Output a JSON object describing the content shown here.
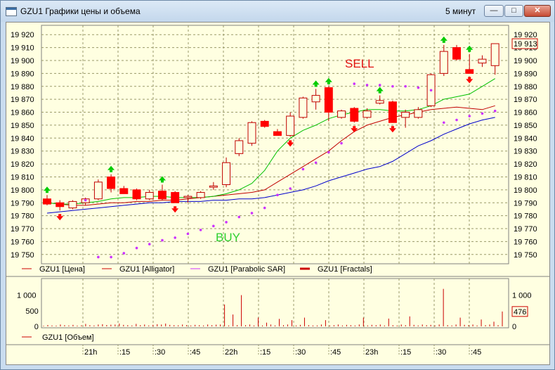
{
  "window": {
    "title": "GZU1 Графики цены и объема",
    "period": "5 минут",
    "btn_min": "—",
    "btn_max": "□",
    "btn_close": "✕"
  },
  "icons": [
    "chart-window-icon",
    "minimize-icon",
    "maximize-icon",
    "close-icon"
  ],
  "colors": {
    "background": "#ffffe1",
    "bear_candle": "#ff0000",
    "bull_candle_border": "#c00000",
    "alligator_green": "#00c000",
    "alligator_red": "#c00000",
    "alligator_blue": "#0000cc",
    "sar": "#cc33ff",
    "fractal_up": "#00cc00",
    "fractal_down": "#ff0000",
    "volume": "#cc0000"
  },
  "chart_data": [
    {
      "type": "candlestick",
      "ylim": [
        19745,
        19925
      ],
      "yticks": [
        19750,
        19760,
        19770,
        19780,
        19790,
        19800,
        19810,
        19820,
        19830,
        19840,
        19850,
        19860,
        19870,
        19880,
        19890,
        19900,
        19910,
        19920
      ],
      "ytick_labels": [
        "19 750",
        "19 760",
        "19 770",
        "19 780",
        "19 790",
        "19 800",
        "19 810",
        "19 820",
        "19 830",
        "19 840",
        "19 850",
        "19 860",
        "19 870",
        "19 880",
        "19 890",
        "19 900",
        "19 910",
        "19 920"
      ],
      "last_price_label": "19 913",
      "grid": true,
      "candles": [
        {
          "o": 19793,
          "h": 19796,
          "l": 19788,
          "c": 19789
        },
        {
          "o": 19790,
          "h": 19792,
          "l": 19784,
          "c": 19787
        },
        {
          "o": 19786,
          "h": 19792,
          "l": 19785,
          "c": 19791
        },
        {
          "o": 19790,
          "h": 19794,
          "l": 19788,
          "c": 19793
        },
        {
          "o": 19793,
          "h": 19808,
          "l": 19792,
          "c": 19806
        },
        {
          "o": 19810,
          "h": 19812,
          "l": 19798,
          "c": 19801
        },
        {
          "o": 19801,
          "h": 19803,
          "l": 19797,
          "c": 19797
        },
        {
          "o": 19800,
          "h": 19801,
          "l": 19792,
          "c": 19793
        },
        {
          "o": 19793,
          "h": 19800,
          "l": 19792,
          "c": 19798
        },
        {
          "o": 19799,
          "h": 19804,
          "l": 19792,
          "c": 19793
        },
        {
          "o": 19798,
          "h": 19799,
          "l": 19790,
          "c": 19790
        },
        {
          "o": 19794,
          "h": 19796,
          "l": 19790,
          "c": 19795
        },
        {
          "o": 19794,
          "h": 19799,
          "l": 19793,
          "c": 19798
        },
        {
          "o": 19802,
          "h": 19806,
          "l": 19800,
          "c": 19803
        },
        {
          "o": 19804,
          "h": 19825,
          "l": 19802,
          "c": 19821
        },
        {
          "o": 19828,
          "h": 19840,
          "l": 19826,
          "c": 19838
        },
        {
          "o": 19836,
          "h": 19853,
          "l": 19834,
          "c": 19852
        },
        {
          "o": 19853,
          "h": 19854,
          "l": 19848,
          "c": 19849
        },
        {
          "o": 19845,
          "h": 19847,
          "l": 19842,
          "c": 19842
        },
        {
          "o": 19842,
          "h": 19860,
          "l": 19841,
          "c": 19857
        },
        {
          "o": 19856,
          "h": 19872,
          "l": 19855,
          "c": 19871
        },
        {
          "o": 19868,
          "h": 19878,
          "l": 19862,
          "c": 19873
        },
        {
          "o": 19879,
          "h": 19880,
          "l": 19853,
          "c": 19860
        },
        {
          "o": 19856,
          "h": 19862,
          "l": 19855,
          "c": 19861
        },
        {
          "o": 19863,
          "h": 19864,
          "l": 19852,
          "c": 19853
        },
        {
          "o": 19856,
          "h": 19863,
          "l": 19855,
          "c": 19861
        },
        {
          "o": 19867,
          "h": 19873,
          "l": 19866,
          "c": 19869
        },
        {
          "o": 19868,
          "h": 19869,
          "l": 19852,
          "c": 19852
        },
        {
          "o": 19856,
          "h": 19862,
          "l": 19848,
          "c": 19860
        },
        {
          "o": 19856,
          "h": 19864,
          "l": 19855,
          "c": 19862
        },
        {
          "o": 19865,
          "h": 19890,
          "l": 19864,
          "c": 19889
        },
        {
          "o": 19890,
          "h": 19912,
          "l": 19888,
          "c": 19907
        },
        {
          "o": 19910,
          "h": 19912,
          "l": 19900,
          "c": 19901
        },
        {
          "o": 19893,
          "h": 19905,
          "l": 19890,
          "c": 19890
        },
        {
          "o": 19898,
          "h": 19904,
          "l": 19895,
          "c": 19901
        },
        {
          "o": 19896,
          "h": 19913,
          "l": 19889,
          "c": 19913
        }
      ],
      "alligator_green": [
        19790,
        19789,
        19789,
        19790,
        19791,
        19793,
        19794,
        19794,
        19795,
        19795,
        19794,
        19794,
        19794,
        19795,
        19797,
        19800,
        19805,
        19815,
        19830,
        19840,
        19846,
        19850,
        19855,
        19858,
        19860,
        19862,
        19862,
        19861,
        19861,
        19862,
        19865,
        19870,
        19872,
        19874,
        19880,
        19886
      ],
      "alligator_red": [
        19790,
        19789,
        19788,
        19788,
        19789,
        19790,
        19790,
        19791,
        19791,
        19792,
        19792,
        19793,
        19794,
        19795,
        19796,
        19797,
        19798,
        19800,
        19806,
        19812,
        19818,
        19824,
        19830,
        19838,
        19845,
        19850,
        19853,
        19856,
        19858,
        19860,
        19862,
        19863,
        19864,
        19863,
        19862,
        19865
      ],
      "alligator_blue": [
        19782,
        19783,
        19784,
        19785,
        19786,
        19787,
        19788,
        19789,
        19790,
        19790,
        19791,
        19791,
        19791,
        19792,
        19792,
        19793,
        19793,
        19794,
        19796,
        19798,
        19800,
        19803,
        19807,
        19810,
        19813,
        19816,
        19818,
        19822,
        19828,
        19834,
        19838,
        19843,
        19847,
        19851,
        19854,
        19856
      ],
      "sar": [
        null,
        null,
        null,
        19792,
        19748,
        19748,
        19751,
        19755,
        19758,
        19761,
        19763,
        19766,
        19769,
        19772,
        19775,
        19779,
        19782,
        19786,
        19796,
        19801,
        19816,
        19821,
        19829,
        19836,
        19882,
        19881,
        19881,
        19880,
        19880,
        19879,
        19877,
        19852,
        19854,
        19857,
        19859,
        19861
      ],
      "fractals_up": [
        0,
        5,
        9,
        21,
        22,
        26,
        31,
        33
      ],
      "fractals_down": [
        1,
        10,
        19,
        24,
        27,
        33
      ],
      "annotations": [
        "SELL",
        "BUY"
      ]
    },
    {
      "type": "bar",
      "title": "GZU1 [Объем]",
      "ylim": [
        0,
        1350
      ],
      "yticks": [
        0,
        500,
        1000
      ],
      "ytick_labels": [
        "0",
        "500",
        "1 000"
      ],
      "last_value_label": "476",
      "values": [
        20,
        45,
        30,
        25,
        60,
        40,
        30,
        50,
        25,
        35,
        80,
        40,
        30,
        60,
        70,
        45,
        55,
        60,
        90,
        50,
        40,
        30,
        80,
        40,
        60,
        30,
        50,
        70,
        60,
        90,
        50,
        40,
        35,
        60,
        45,
        30,
        50,
        40,
        30,
        60,
        40,
        55,
        60,
        700,
        30,
        380,
        40,
        1000,
        40,
        60,
        30,
        280,
        30,
        120,
        60,
        30,
        240,
        40,
        60,
        200,
        30,
        50,
        280,
        40,
        30,
        30,
        60,
        200,
        30,
        40,
        60,
        30,
        50,
        40,
        30,
        60,
        280,
        30,
        50,
        40,
        60,
        30,
        250,
        40,
        30,
        60,
        40,
        320,
        50,
        30,
        60,
        40,
        50,
        30,
        60,
        1200,
        40,
        30,
        60,
        280,
        50,
        40,
        60,
        30,
        220,
        40,
        60,
        150,
        40,
        476
      ]
    }
  ],
  "legend": [
    {
      "name": "GZU1 [Цена]",
      "color": "#cc0000",
      "style": "thin"
    },
    {
      "name": "GZU1 [Alligator]",
      "color": "#cc0000",
      "style": "thin"
    },
    {
      "name": "GZU1 [Parabolic SAR]",
      "color": "#cc33ff",
      "style": "thin"
    },
    {
      "name": "GZU1 [Fractals]",
      "color": "#cc0000",
      "style": "thick"
    }
  ],
  "volume_legend": {
    "name": "GZU1 [Объем]",
    "color": "#cc0000"
  },
  "time_axis": [
    "21h",
    ":15",
    ":30",
    ":45",
    "22h",
    ":15",
    ":30",
    ":45",
    "23h",
    ":15",
    ":30",
    ":45"
  ]
}
